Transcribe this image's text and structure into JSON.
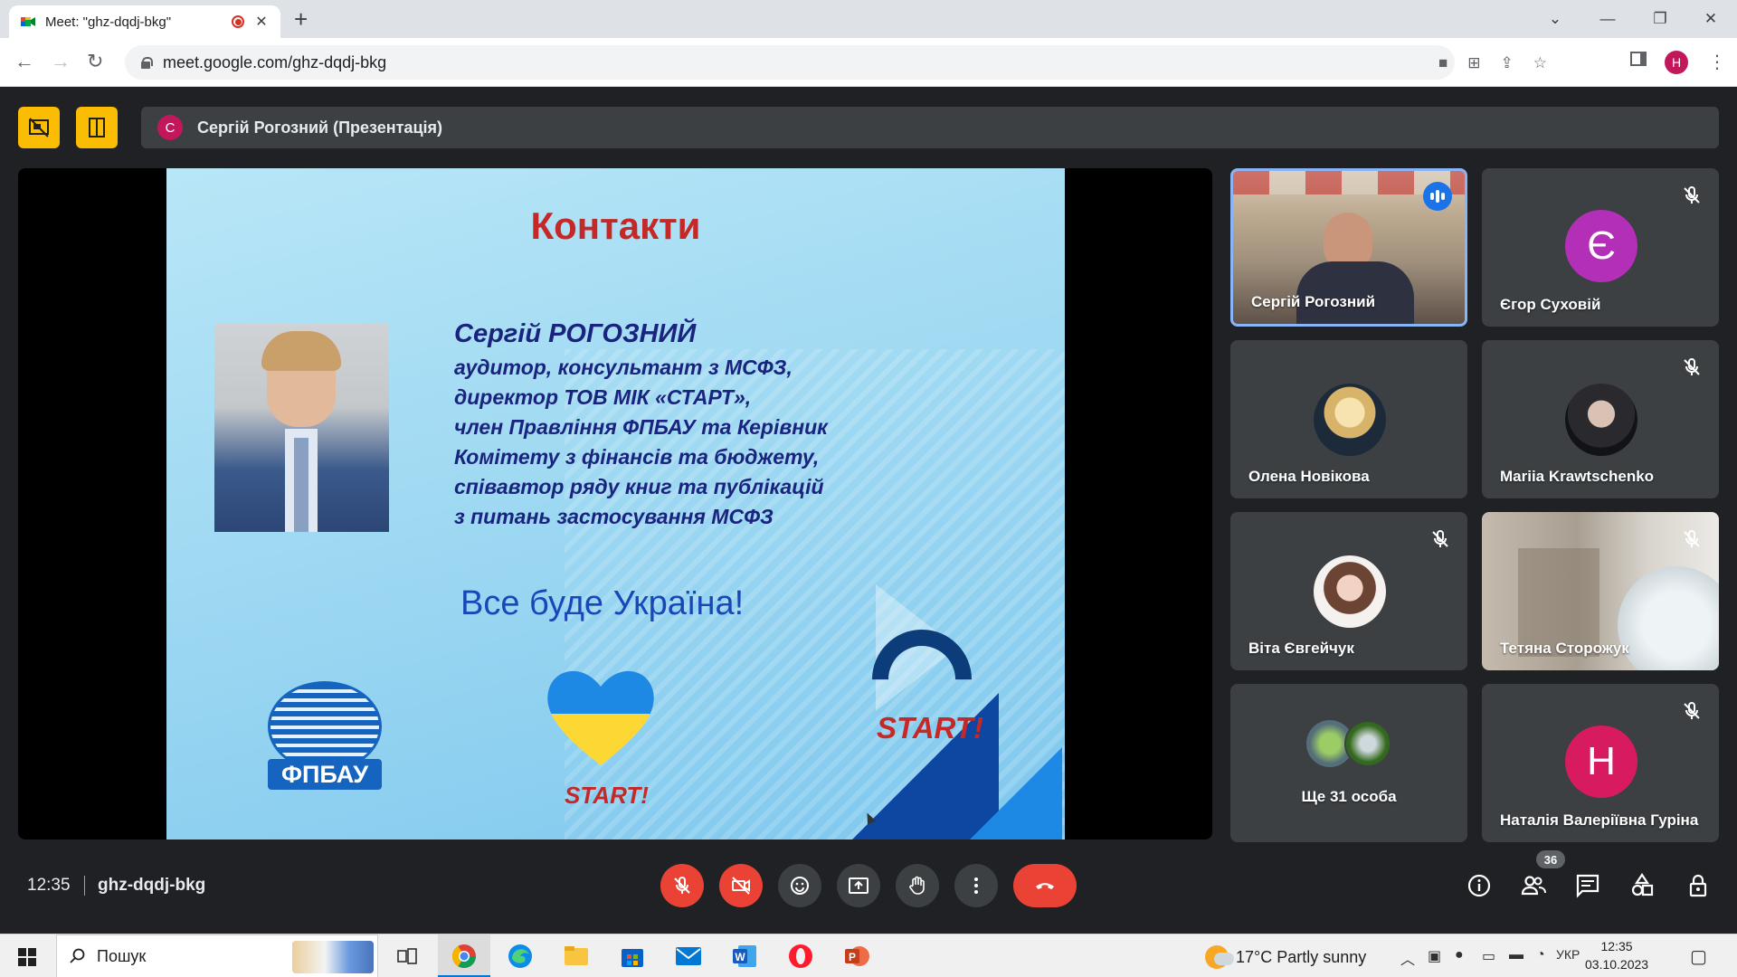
{
  "browser": {
    "tab_title": "Meet: \"ghz-dqdj-bkg\"",
    "new_tab": "+",
    "url": "meet.google.com/ghz-dqdj-bkg",
    "profile_letter": "H"
  },
  "meet": {
    "presenter_avatar_letter": "С",
    "presenter_label": "Сергій Рогозний (Презентація)",
    "time": "12:35",
    "meeting_code": "ghz-dqdj-bkg",
    "participant_count": "36"
  },
  "slide": {
    "title": "Контакти",
    "name": "Сергій РОГОЗНИЙ",
    "bio_lines": [
      "аудитор, консультант з МСФЗ,",
      "директор ТОВ МІК «СТАРТ»,",
      "член Правління ФПБАУ та Керівник",
      "Комітету з фінансів та бюджету,",
      "співавтор ряду книг та публікацій",
      "з питань застосування МСФЗ"
    ],
    "motto": "Все буде Україна!",
    "logo_fpbau": "ФПБАУ",
    "logo_start_small": "START!",
    "logo_start_big": "START!"
  },
  "participants": [
    {
      "name": "Сергій Рогозний",
      "type": "video",
      "speaking": true
    },
    {
      "name": "Єгор Суховій",
      "type": "letter",
      "letter": "Є",
      "color": "#b32fb7",
      "muted": true
    },
    {
      "name": "Олена Новікова",
      "type": "photo",
      "muted": false
    },
    {
      "name": "Mariia Krawtschenko",
      "type": "photo",
      "muted": true
    },
    {
      "name": "Віта Євгейчук",
      "type": "photo",
      "muted": true
    },
    {
      "name": "Тетяна Сторожук",
      "type": "video",
      "muted": true
    },
    {
      "name": "Ще 31 особа",
      "type": "group"
    },
    {
      "name": "Наталія Валеріївна Гуріна",
      "type": "letter",
      "letter": "Н",
      "color": "#d81b60",
      "muted": true
    }
  ],
  "taskbar": {
    "search_placeholder": "Пошук",
    "weather": "17°C  Partly sunny",
    "language": "УКР",
    "clock_time": "12:35",
    "clock_date": "03.10.2023"
  },
  "colors": {
    "meet_bg": "#202124",
    "tile_bg": "#3c4043",
    "end_call": "#ea4335",
    "accent_yellow": "#fbbc04"
  }
}
